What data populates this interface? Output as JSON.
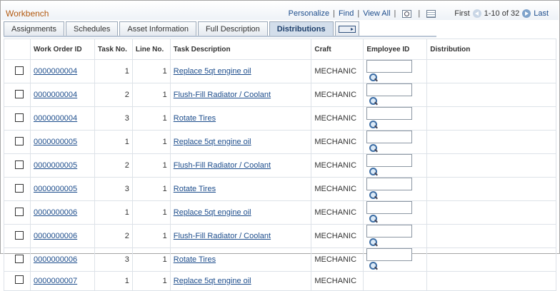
{
  "title": "Workbench",
  "nav": {
    "personalize": "Personalize",
    "find": "Find",
    "view_all": "View All",
    "first": "First",
    "range": "1-10 of 32",
    "last": "Last"
  },
  "tabs": [
    {
      "label": "Assignments"
    },
    {
      "label": "Schedules"
    },
    {
      "label": "Asset Information"
    },
    {
      "label": "Full Description"
    },
    {
      "label": "Distributions"
    }
  ],
  "columns": {
    "work_order_id": "Work Order ID",
    "task_no": "Task No.",
    "line_no": "Line No.",
    "task_description": "Task Description",
    "craft": "Craft",
    "employee_id": "Employee ID",
    "distribution": "Distribution"
  },
  "rows": [
    {
      "wo": "0000000004",
      "task": "1",
      "line": "1",
      "desc": "Replace 5qt engine oil",
      "craft": "MECHANIC"
    },
    {
      "wo": "0000000004",
      "task": "2",
      "line": "1",
      "desc": "Flush-Fill Radiator / Coolant",
      "craft": "MECHANIC"
    },
    {
      "wo": "0000000004",
      "task": "3",
      "line": "1",
      "desc": "Rotate Tires",
      "craft": "MECHANIC"
    },
    {
      "wo": "0000000005",
      "task": "1",
      "line": "1",
      "desc": "Replace 5qt engine oil",
      "craft": "MECHANIC"
    },
    {
      "wo": "0000000005",
      "task": "2",
      "line": "1",
      "desc": "Flush-Fill Radiator / Coolant",
      "craft": "MECHANIC"
    },
    {
      "wo": "0000000005",
      "task": "3",
      "line": "1",
      "desc": "Rotate Tires",
      "craft": "MECHANIC"
    },
    {
      "wo": "0000000006",
      "task": "1",
      "line": "1",
      "desc": "Replace 5qt engine oil",
      "craft": "MECHANIC"
    },
    {
      "wo": "0000000006",
      "task": "2",
      "line": "1",
      "desc": "Flush-Fill Radiator / Coolant",
      "craft": "MECHANIC"
    },
    {
      "wo": "0000000006",
      "task": "3",
      "line": "1",
      "desc": "Rotate Tires",
      "craft": "MECHANIC"
    },
    {
      "wo": "0000000007",
      "task": "1",
      "line": "1",
      "desc": "Replace 5qt engine oil",
      "craft": "MECHANIC"
    }
  ]
}
